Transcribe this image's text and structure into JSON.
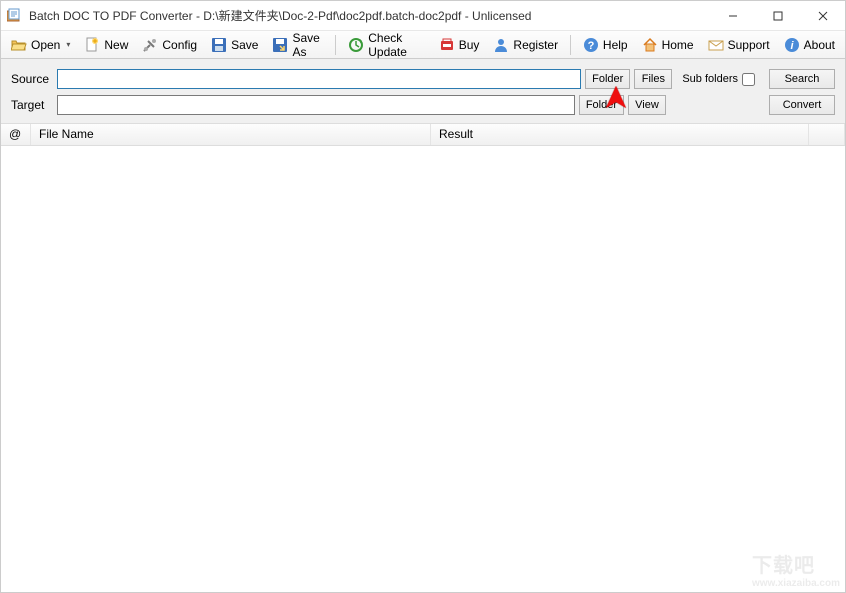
{
  "titlebar": {
    "title": "Batch DOC TO PDF Converter - D:\\新建文件夹\\Doc-2-Pdf\\doc2pdf.batch-doc2pdf - Unlicensed"
  },
  "toolbar": {
    "open": "Open",
    "new": "New",
    "config": "Config",
    "save": "Save",
    "save_as": "Save As",
    "check_update": "Check Update",
    "buy": "Buy",
    "register": "Register",
    "help": "Help",
    "home": "Home",
    "support": "Support",
    "about": "About"
  },
  "form": {
    "source_label": "Source",
    "source_value": "",
    "target_label": "Target",
    "target_value": "",
    "folder_btn": "Folder",
    "files_btn": "Files",
    "view_btn": "View",
    "sub_folders_label": "Sub folders",
    "sub_folders_checked": false,
    "search_btn": "Search",
    "convert_btn": "Convert"
  },
  "list": {
    "col_at": "@",
    "col_file": "File Name",
    "col_result": "Result"
  },
  "watermark": {
    "big": "下载吧",
    "domain": "www.xiazaiba.com"
  }
}
